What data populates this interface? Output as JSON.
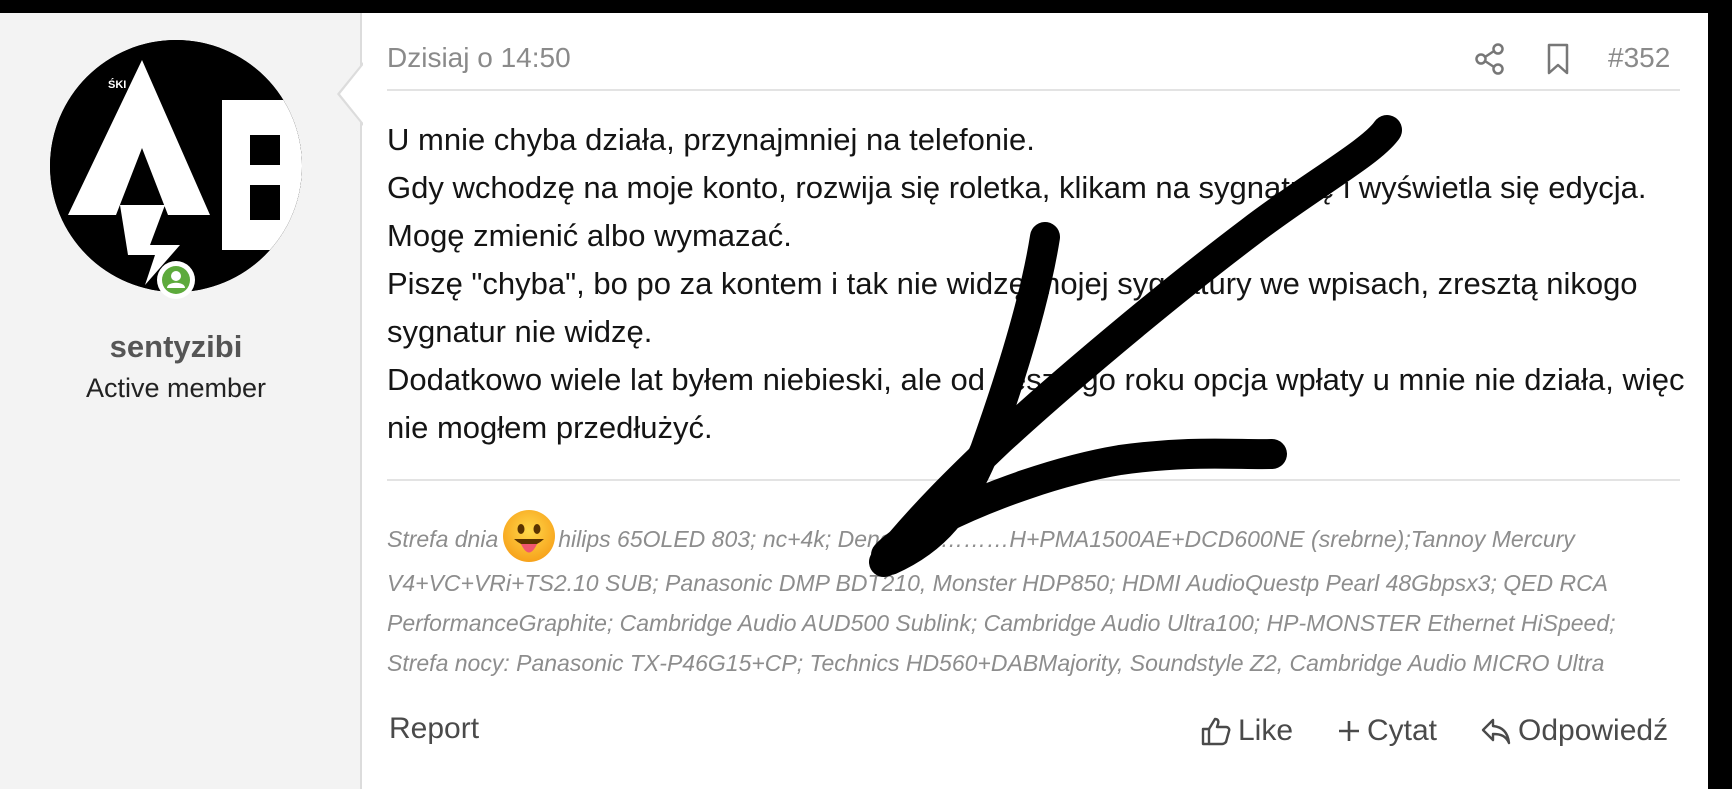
{
  "user": {
    "username": "sentyzibi",
    "title": "Active member",
    "avatar_text": "ŚKI"
  },
  "post": {
    "date": "Dzisiaj o 14:50",
    "number": "#352",
    "body_lines": [
      "U mnie chyba działa, przynajmniej na telefonie.",
      "Gdy wchodzę na moje konto, rozwija się roletka, klikam na sygnaturę i wyświetla się edycja. Mogę zmienić albo wymazać.",
      "Piszę \"chyba\", bo po za kontem i tak nie widzę mojej sygnatury we wpisach, zresztą nikogo sygnatur nie widzę.",
      "Dodatkowo wiele lat byłem niebieski, ale od zeszłego roku opcja wpłaty u mnie nie działa, więc nie mogłem przedłużyć."
    ]
  },
  "signature": {
    "line1_prefix": "Strefa dnia",
    "line1_suffix": "hilips 65OLED 803; nc+4k; Denon AV………H+PMA1500AE+DCD600NE (srebrne);Tannoy Mercury",
    "line2": "V4+VC+VRi+TS2.10 SUB; Panasonic DMP BDT210, Monster HDP850; HDMI AudioQuestp Pearl 48Gbpsx3; QED RCA",
    "line3": "PerformanceGraphite; Cambridge Audio AUD500 Sublink; Cambridge Audio Ultra100; HP-MONSTER Ethernet HiSpeed;",
    "line4": "Strefa nocy: Panasonic TX-P46G15+CP; Technics HD560+DABMajority, Soundstyle Z2, Cambridge Audio MICRO Ultra"
  },
  "actions": {
    "report": "Report",
    "like": "Like",
    "quote": "Cytat",
    "reply": "Odpowiedź"
  },
  "icons": {
    "share": "share-icon",
    "bookmark": "bookmark-icon",
    "like": "thumbs-up-icon",
    "quote": "plus-icon",
    "reply": "reply-arrow-icon",
    "online": "user-online-icon",
    "emoji": "tongue-out-emoji-icon"
  },
  "colors": {
    "online_badge": "#5daa3c",
    "meta_text": "#8a8a8a",
    "signature_text": "#8d8d8d",
    "panel_bg": "#f3f3f3"
  }
}
